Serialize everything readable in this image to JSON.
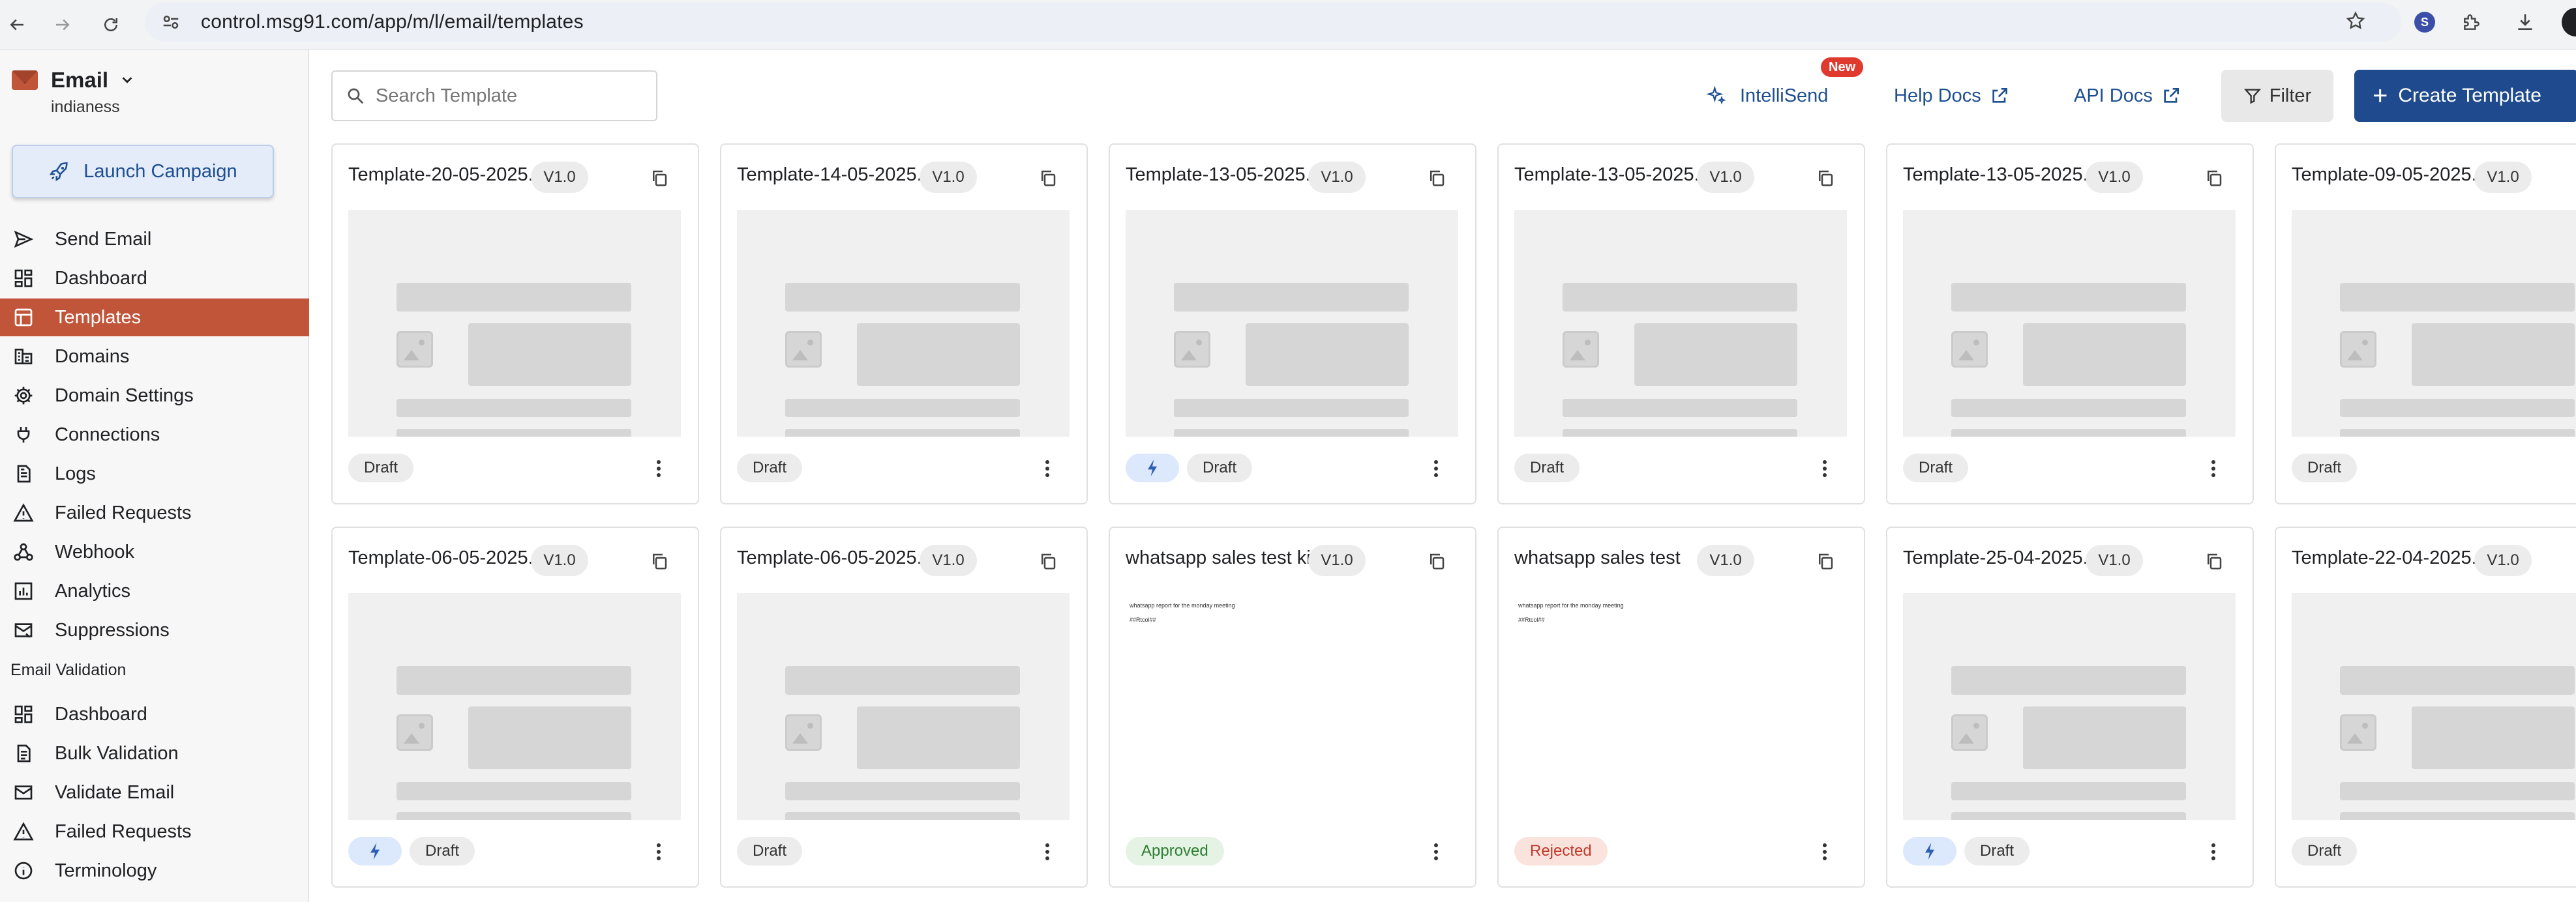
{
  "browser": {
    "url": "control.msg91.com/app/m/l/email/templates",
    "extension_letter": "S"
  },
  "sidebar": {
    "product": "Email",
    "account": "indianess",
    "launch_label": "Launch Campaign",
    "items": [
      {
        "label": "Send Email",
        "icon": "send-icon"
      },
      {
        "label": "Dashboard",
        "icon": "dashboard-icon"
      },
      {
        "label": "Templates",
        "icon": "templates-icon",
        "active": true
      },
      {
        "label": "Domains",
        "icon": "domains-icon"
      },
      {
        "label": "Domain Settings",
        "icon": "gear-icon"
      },
      {
        "label": "Connections",
        "icon": "plug-icon"
      },
      {
        "label": "Logs",
        "icon": "logs-icon"
      },
      {
        "label": "Failed Requests",
        "icon": "warning-icon"
      },
      {
        "label": "Webhook",
        "icon": "webhook-icon"
      },
      {
        "label": "Analytics",
        "icon": "analytics-icon"
      },
      {
        "label": "Suppressions",
        "icon": "suppressions-icon"
      }
    ],
    "section_label": "Email Validation",
    "validation_items": [
      {
        "label": "Dashboard",
        "icon": "dashboard-icon"
      },
      {
        "label": "Bulk Validation",
        "icon": "bulk-validation-icon"
      },
      {
        "label": "Validate Email",
        "icon": "mail-icon"
      },
      {
        "label": "Failed Requests",
        "icon": "warning-icon"
      },
      {
        "label": "Terminology",
        "icon": "info-icon"
      }
    ]
  },
  "header": {
    "search_placeholder": "Search Template",
    "intellisend_label": "IntelliSend",
    "new_badge": "New",
    "help_docs": "Help Docs",
    "api_docs": "API Docs",
    "filter_label": "Filter",
    "create_label": "Create Template"
  },
  "colors": {
    "accent": "#c0553a",
    "primary": "#1f4b8e",
    "link": "#1e4f91"
  },
  "templates": [
    {
      "name": "Template-20-05-2025...",
      "version": "V1.0",
      "status": "Draft",
      "bolt": false,
      "preview": "placeholder"
    },
    {
      "name": "Template-14-05-2025...",
      "version": "V1.0",
      "status": "Draft",
      "bolt": false,
      "preview": "placeholder"
    },
    {
      "name": "Template-13-05-2025...",
      "version": "V1.0",
      "status": "Draft",
      "bolt": true,
      "preview": "placeholder"
    },
    {
      "name": "Template-13-05-2025...",
      "version": "V1.0",
      "status": "Draft",
      "bolt": false,
      "preview": "placeholder"
    },
    {
      "name": "Template-13-05-2025...",
      "version": "V1.0",
      "status": "Draft",
      "bolt": false,
      "preview": "placeholder"
    },
    {
      "name": "Template-09-05-2025...",
      "version": "V1.0",
      "status": "Draft",
      "bolt": false,
      "preview": "placeholder"
    },
    {
      "name": "Template-06-05-2025...",
      "version": "V1.0",
      "status": "Draft",
      "bolt": true,
      "preview": "placeholder"
    },
    {
      "name": "Template-06-05-2025...",
      "version": "V1.0",
      "status": "Draft",
      "bolt": false,
      "preview": "placeholder"
    },
    {
      "name": "whatsapp sales test kiwi",
      "version": "V1.0",
      "status": "Approved",
      "bolt": false,
      "preview": "text",
      "preview_lines": [
        "whatsapp report for the monday meeting",
        "##Rtcol##"
      ]
    },
    {
      "name": "whatsapp sales test",
      "version": "V1.0",
      "status": "Rejected",
      "bolt": false,
      "preview": "text",
      "preview_lines": [
        "whatsapp report for the monday meeting",
        "##Rtcol##"
      ]
    },
    {
      "name": "Template-25-04-2025...",
      "version": "V1.0",
      "status": "Draft",
      "bolt": true,
      "preview": "placeholder"
    },
    {
      "name": "Template-22-04-2025...",
      "version": "V1.0",
      "status": "Draft",
      "bolt": false,
      "preview": "placeholder"
    }
  ]
}
